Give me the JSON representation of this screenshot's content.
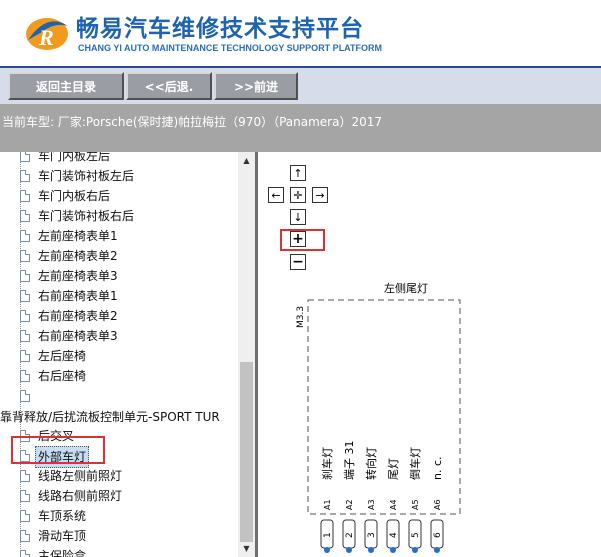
{
  "header": {
    "title": "畅易汽车维修技术支持平台",
    "subtitle": "CHANG YI AUTO MAINTENANCE TECHNOLOGY SUPPORT PLATFORM",
    "logo_letter": "R"
  },
  "toolbar": {
    "home_label": "返回主目录",
    "back_label": "<<后退.",
    "forward_label": ">>前进"
  },
  "info": {
    "current_vehicle": "当前车型:  厂家:Porsche(保时捷)帕拉梅拉（970）（Panamera）2017"
  },
  "tree": {
    "items": [
      {
        "label": "车门内板左后"
      },
      {
        "label": "车门装饰衬板左后"
      },
      {
        "label": "车门内板右后"
      },
      {
        "label": "车门装饰衬板右后"
      },
      {
        "label": "左前座椅表单1"
      },
      {
        "label": "左前座椅表单2"
      },
      {
        "label": "左前座椅表单3"
      },
      {
        "label": "右前座椅表单1"
      },
      {
        "label": "右前座椅表单2"
      },
      {
        "label": "右前座椅表单3"
      },
      {
        "label": "左后座椅"
      },
      {
        "label": "右后座椅"
      },
      {
        "label": ""
      }
    ],
    "parent_label": "靠背释放/后扰流板控制单元-SPORT TUR",
    "items2": [
      {
        "label": "后交叉"
      },
      {
        "label": "外部车灯"
      },
      {
        "label": "线路左侧前照灯"
      },
      {
        "label": "线路右侧前照灯"
      },
      {
        "label": "车顶系统"
      },
      {
        "label": "滑动车顶"
      },
      {
        "label": "主保险盒"
      }
    ]
  },
  "diagram": {
    "component_title": "左侧尾灯",
    "connector_id": "M3.3",
    "pin_labels": [
      "刹车灯",
      "端子 31",
      "转向灯",
      "尾灯",
      "倒车灯",
      "n. c."
    ],
    "pin_ids": [
      "A1",
      "A2",
      "A3",
      "A4",
      "A5",
      "A6"
    ],
    "pin_numbers": [
      "1",
      "2",
      "3",
      "4",
      "5",
      "6"
    ]
  },
  "colors": {
    "brand_blue": "#1d63b0",
    "toolbar_bg": "#d6dcea",
    "button_bg": "#9a9da3",
    "info_bg": "#a5a5a5",
    "highlight_red": "#e03131",
    "selection_bg": "#c8dcf4",
    "pin_blue": "#1f6fd1"
  },
  "icons": {
    "pan_up": "arrow-up-icon",
    "pan_left": "arrow-left-icon",
    "pan_center": "move-center-icon",
    "pan_right": "arrow-right-icon",
    "pan_down": "arrow-down-icon",
    "zoom_in": "plus-icon",
    "zoom_out": "minus-icon"
  }
}
